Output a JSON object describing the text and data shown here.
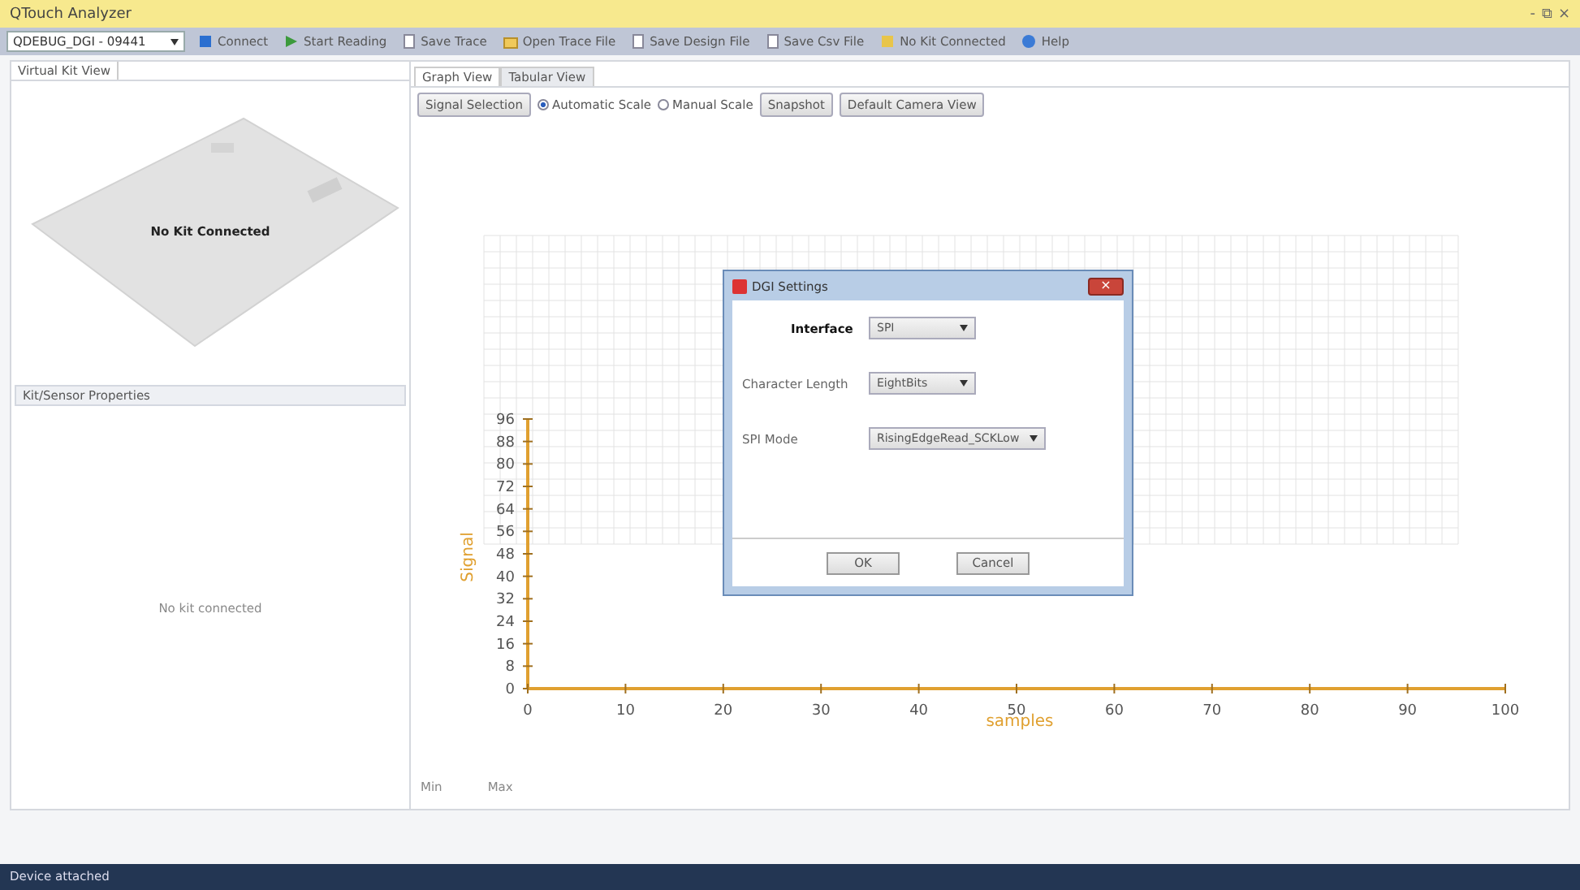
{
  "window": {
    "title": "QTouch Analyzer",
    "controls": [
      "-",
      "⧉",
      "×"
    ]
  },
  "toolbar": {
    "device": "QDEBUG_DGI - 09441",
    "items": [
      {
        "label": "Connect",
        "kind": "connect"
      },
      {
        "label": "Start Reading",
        "kind": "play"
      },
      {
        "label": "Save Trace",
        "kind": "doc"
      },
      {
        "label": "Open Trace File",
        "kind": "folder"
      },
      {
        "label": "Save Design File",
        "kind": "doc"
      },
      {
        "label": "Save Csv File",
        "kind": "doc"
      },
      {
        "label": "No Kit Connected",
        "kind": "kit"
      },
      {
        "label": "Help",
        "kind": "help"
      }
    ]
  },
  "left": {
    "kit_view_tab": "Virtual Kit View",
    "kit_image_label": "No Kit Connected",
    "properties_header": "Kit/Sensor Properties",
    "properties_empty": "No kit connected"
  },
  "tabs": [
    {
      "label": "Graph View",
      "selected": true
    },
    {
      "label": "Tabular View",
      "selected": false
    }
  ],
  "graph_toolbar": {
    "signal_button": "Signal Selection",
    "scales": [
      {
        "label": "Automatic Scale",
        "selected": true
      },
      {
        "label": "Manual Scale",
        "selected": false
      }
    ],
    "buttons": [
      "Snapshot",
      "Default Camera View"
    ]
  },
  "chart_data": {
    "type": "line",
    "xlabel": "samples",
    "ylabel": "Signal",
    "xlim": [
      0,
      100
    ],
    "ylim": [
      0,
      96
    ],
    "xticks": [
      0,
      10,
      20,
      30,
      40,
      50,
      60,
      70,
      80,
      90,
      100
    ],
    "yticks": [
      0,
      8,
      16,
      24,
      32,
      40,
      48,
      56,
      64,
      72,
      80,
      88,
      96
    ],
    "grid": true
  },
  "legend": [
    "Min",
    "Max"
  ],
  "dialog": {
    "title": "DGI Settings",
    "fields": [
      {
        "label": "Interface",
        "value": "SPI",
        "bold": true
      },
      {
        "label": "Character Length",
        "value": "EightBits",
        "bold": false
      },
      {
        "label": "SPI Mode",
        "value": "RisingEdgeRead_SCKLow",
        "bold": false
      }
    ],
    "buttons": [
      "OK",
      "Cancel"
    ]
  },
  "status_bar": "Device attached"
}
